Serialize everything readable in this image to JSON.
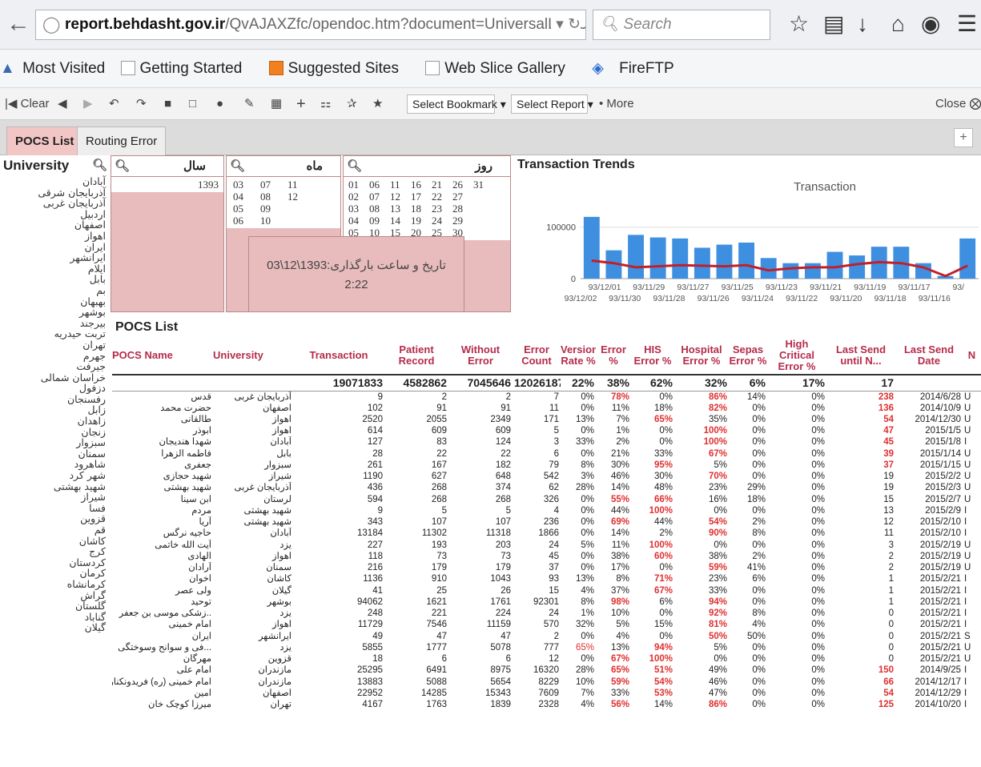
{
  "browser": {
    "url_host": "report.behdasht.gov.ir",
    "url_path": "/QvAJAXZfc/opendoc.htm?document=UniversalLog Universities.qvw&h",
    "search_placeholder": "Search",
    "bookmarks": [
      "Most Visited",
      "Getting Started",
      "Suggested Sites",
      "Web Slice Gallery",
      "FireFTP"
    ]
  },
  "toolbar": {
    "clear": "Clear",
    "select_bookmark": "Select Bookmark",
    "select_report": "Select Report",
    "more": "More",
    "close": "Close"
  },
  "tabs": [
    "POCS List",
    "Routing Error"
  ],
  "university_panel": {
    "title": "University",
    "items": [
      "آبادان",
      "آذربایجان شرقی",
      "آذربایجان غربی",
      "اردبیل",
      "اصفهان",
      "اهواز",
      "ایران",
      "ایرانشهر",
      "ایلام",
      "بابل",
      "بم",
      "بهبهان",
      "بوشهر",
      "بیرجند",
      "تربت حیدریه",
      "تهران",
      "جهرم",
      "جیرفت",
      "خراسان شمالی",
      "دزفول",
      "رفسنجان",
      "زابل",
      "زاهدان",
      "زنجان",
      "سبزوار",
      "سمنان",
      "شاهرود",
      "شهر کرد",
      "شهید بهشتی",
      "شیراز",
      "فسا",
      "قزوین",
      "قم",
      "کاشان",
      "کرج",
      "کردستان",
      "کرمان",
      "کرمانشاه",
      "گراش",
      "گلستان",
      "گناباد",
      "گیلان"
    ]
  },
  "filters": {
    "year": {
      "title": "سال",
      "values": [
        "1393"
      ]
    },
    "month": {
      "title": "ماه",
      "values": [
        "03",
        "07",
        "11",
        "04",
        "08",
        "12",
        "05",
        "09",
        "",
        "06",
        "10",
        ""
      ]
    },
    "day": {
      "title": "روز",
      "values": [
        "01",
        "06",
        "11",
        "16",
        "21",
        "26",
        "31",
        "02",
        "07",
        "12",
        "17",
        "22",
        "27",
        "",
        "03",
        "08",
        "13",
        "18",
        "23",
        "28",
        "",
        "04",
        "09",
        "14",
        "19",
        "24",
        "29",
        "",
        "05",
        "10",
        "15",
        "20",
        "25",
        "30",
        ""
      ]
    }
  },
  "upload_label": "تاریخ و ساعت بارگذاری:1393\\12\\03",
  "upload_time": "2:22",
  "trends": {
    "panel_title": "Transaction Trends"
  },
  "chart_data": {
    "type": "bar",
    "title": "Transaction",
    "ytick_labels": [
      "100000",
      "0"
    ],
    "ylim": [
      0,
      140000
    ],
    "categories_top": [
      "93/12/01",
      "93/11/29",
      "93/11/27",
      "93/11/25",
      "93/11/23",
      "93/11/21",
      "93/11/19",
      "93/11/17",
      "93/"
    ],
    "categories_bottom": [
      "93/12/02",
      "93/11/30",
      "93/11/28",
      "93/11/26",
      "93/11/24",
      "93/11/22",
      "93/11/20",
      "93/11/18",
      "93/11/16"
    ],
    "values": [
      120000,
      55000,
      85000,
      80000,
      78000,
      60000,
      66000,
      70000,
      40000,
      30000,
      30000,
      52000,
      45000,
      62000,
      62000,
      30000,
      5000,
      78000
    ],
    "line": [
      35000,
      30000,
      22000,
      24000,
      26000,
      25000,
      24000,
      26000,
      16000,
      20000,
      22000,
      22000,
      28000,
      32000,
      30000,
      22000,
      5000,
      25000
    ]
  },
  "pocs": {
    "title": "POCS List",
    "columns": [
      "POCS Name",
      "University",
      "Transaction",
      "Patient Record",
      "Without Error",
      "Error Count",
      "Version Rate %",
      "Error %",
      "HIS Error %",
      "Hospital Error %",
      "Sepas Error %",
      "High Critical Error %",
      "Last Send until N...",
      "Last Send Date",
      "N"
    ],
    "totals": [
      "",
      "",
      "19071833",
      "4582862",
      "7045646",
      "12026187",
      "22%",
      "38%",
      "62%",
      "32%",
      "6%",
      "17%",
      "17",
      "",
      ""
    ],
    "rows": [
      [
        "قدس",
        "آذربایجان غربی",
        "9",
        "2",
        "2",
        "7",
        "0%",
        "78%",
        "0%",
        "86%",
        "14%",
        "0%",
        "238",
        "2014/6/28",
        "U"
      ],
      [
        "حضرت محمد",
        "اصفهان",
        "102",
        "91",
        "91",
        "11",
        "0%",
        "11%",
        "18%",
        "82%",
        "0%",
        "0%",
        "136",
        "2014/10/9",
        "U"
      ],
      [
        "طالقانی",
        "اهواز",
        "2520",
        "2055",
        "2349",
        "171",
        "13%",
        "7%",
        "65%",
        "35%",
        "0%",
        "0%",
        "54",
        "2014/12/30",
        "U"
      ],
      [
        "ابوذر",
        "اهواز",
        "614",
        "609",
        "609",
        "5",
        "0%",
        "1%",
        "0%",
        "100%",
        "0%",
        "0%",
        "47",
        "2015/1/5",
        "U"
      ],
      [
        "شهدا هندیجان",
        "آبادان",
        "127",
        "83",
        "124",
        "3",
        "33%",
        "2%",
        "0%",
        "100%",
        "0%",
        "0%",
        "45",
        "2015/1/8",
        "I"
      ],
      [
        "فاطمه الزهرا",
        "بابل",
        "28",
        "22",
        "22",
        "6",
        "0%",
        "21%",
        "33%",
        "67%",
        "0%",
        "0%",
        "39",
        "2015/1/14",
        "U"
      ],
      [
        "جعفری",
        "سبزوار",
        "261",
        "167",
        "182",
        "79",
        "8%",
        "30%",
        "95%",
        "5%",
        "0%",
        "0%",
        "37",
        "2015/1/15",
        "U"
      ],
      [
        "شهید حجازی",
        "شیراز",
        "1190",
        "627",
        "648",
        "542",
        "3%",
        "46%",
        "30%",
        "70%",
        "0%",
        "0%",
        "19",
        "2015/2/2",
        "U"
      ],
      [
        "شهید بهشتی",
        "آذربایجان غربی",
        "436",
        "268",
        "374",
        "62",
        "28%",
        "14%",
        "48%",
        "23%",
        "29%",
        "0%",
        "19",
        "2015/2/3",
        "U"
      ],
      [
        "ابن سینا",
        "لرستان",
        "594",
        "268",
        "268",
        "326",
        "0%",
        "55%",
        "66%",
        "16%",
        "18%",
        "0%",
        "15",
        "2015/2/7",
        "U"
      ],
      [
        "مردم",
        "شهید بهشتی",
        "9",
        "5",
        "5",
        "4",
        "0%",
        "44%",
        "100%",
        "0%",
        "0%",
        "0%",
        "13",
        "2015/2/9",
        "I"
      ],
      [
        "آریا",
        "شهید بهشتی",
        "343",
        "107",
        "107",
        "236",
        "0%",
        "69%",
        "44%",
        "54%",
        "2%",
        "0%",
        "12",
        "2015/2/10",
        "I"
      ],
      [
        "حاجیه نرگس",
        "آبادان",
        "13184",
        "11302",
        "11318",
        "1866",
        "0%",
        "14%",
        "2%",
        "90%",
        "8%",
        "0%",
        "11",
        "2015/2/10",
        "I"
      ],
      [
        "آیت الله خاتمی",
        "یزد",
        "227",
        "193",
        "203",
        "24",
        "5%",
        "11%",
        "100%",
        "0%",
        "0%",
        "0%",
        "3",
        "2015/2/19",
        "U"
      ],
      [
        "الهادی",
        "اهواز",
        "118",
        "73",
        "73",
        "45",
        "0%",
        "38%",
        "60%",
        "38%",
        "2%",
        "0%",
        "2",
        "2015/2/19",
        "U"
      ],
      [
        "آرادان",
        "سمنان",
        "216",
        "179",
        "179",
        "37",
        "0%",
        "17%",
        "0%",
        "59%",
        "41%",
        "0%",
        "2",
        "2015/2/19",
        "U"
      ],
      [
        "اخوان",
        "کاشان",
        "1136",
        "910",
        "1043",
        "93",
        "13%",
        "8%",
        "71%",
        "23%",
        "6%",
        "0%",
        "1",
        "2015/2/21",
        "I"
      ],
      [
        "ولی عصر",
        "گیلان",
        "41",
        "25",
        "26",
        "15",
        "4%",
        "37%",
        "67%",
        "33%",
        "0%",
        "0%",
        "1",
        "2015/2/21",
        "I"
      ],
      [
        "توحید",
        "بوشهر",
        "94062",
        "1621",
        "1761",
        "92301",
        "8%",
        "98%",
        "6%",
        "94%",
        "0%",
        "0%",
        "1",
        "2015/2/21",
        "I"
      ],
      [
        "..زشکی موسی بن جعفر",
        "یزد",
        "248",
        "221",
        "224",
        "24",
        "1%",
        "10%",
        "0%",
        "92%",
        "8%",
        "0%",
        "0",
        "2015/2/21",
        "I"
      ],
      [
        "امام خمینی",
        "اهواز",
        "11729",
        "7546",
        "11159",
        "570",
        "32%",
        "5%",
        "15%",
        "81%",
        "4%",
        "0%",
        "0",
        "2015/2/21",
        "I"
      ],
      [
        "ایران",
        "ایرانشهر",
        "49",
        "47",
        "47",
        "2",
        "0%",
        "4%",
        "0%",
        "50%",
        "50%",
        "0%",
        "0",
        "2015/2/21",
        "S"
      ],
      [
        "...فی و سوانح وسوختگی",
        "یزد",
        "5855",
        "1777",
        "5078",
        "777",
        "65%",
        "13%",
        "94%",
        "5%",
        "0%",
        "0%",
        "0",
        "2015/2/21",
        "U"
      ],
      [
        "مهرگان",
        "قزوین",
        "18",
        "6",
        "6",
        "12",
        "0%",
        "67%",
        "100%",
        "0%",
        "0%",
        "0%",
        "0",
        "2015/2/21",
        "U"
      ],
      [
        "امام علی",
        "مازندران",
        "25295",
        "6491",
        "8975",
        "16320",
        "28%",
        "65%",
        "51%",
        "49%",
        "0%",
        "0%",
        "150",
        "2014/9/25",
        "I"
      ],
      [
        "امام خمینی (ره) فریدونکنار",
        "مازندران",
        "13883",
        "5088",
        "5654",
        "8229",
        "10%",
        "59%",
        "54%",
        "46%",
        "0%",
        "0%",
        "66",
        "2014/12/17",
        "I"
      ],
      [
        "امین",
        "اصفهان",
        "22952",
        "14285",
        "15343",
        "7609",
        "7%",
        "33%",
        "53%",
        "47%",
        "0%",
        "0%",
        "54",
        "2014/12/29",
        "I"
      ],
      [
        "میرزا کوچک خان",
        "تهران",
        "4167",
        "1763",
        "1839",
        "2328",
        "4%",
        "56%",
        "14%",
        "86%",
        "0%",
        "0%",
        "125",
        "2014/10/20",
        "I"
      ]
    ]
  }
}
